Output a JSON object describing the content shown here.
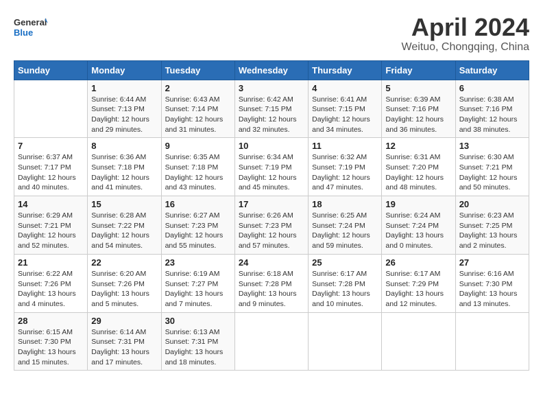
{
  "header": {
    "logo_general": "General",
    "logo_blue": "Blue",
    "month_year": "April 2024",
    "location": "Weituo, Chongqing, China"
  },
  "columns": [
    "Sunday",
    "Monday",
    "Tuesday",
    "Wednesday",
    "Thursday",
    "Friday",
    "Saturday"
  ],
  "weeks": [
    [
      {
        "day": "",
        "sunrise": "",
        "sunset": "",
        "daylight": ""
      },
      {
        "day": "1",
        "sunrise": "Sunrise: 6:44 AM",
        "sunset": "Sunset: 7:13 PM",
        "daylight": "Daylight: 12 hours and 29 minutes."
      },
      {
        "day": "2",
        "sunrise": "Sunrise: 6:43 AM",
        "sunset": "Sunset: 7:14 PM",
        "daylight": "Daylight: 12 hours and 31 minutes."
      },
      {
        "day": "3",
        "sunrise": "Sunrise: 6:42 AM",
        "sunset": "Sunset: 7:15 PM",
        "daylight": "Daylight: 12 hours and 32 minutes."
      },
      {
        "day": "4",
        "sunrise": "Sunrise: 6:41 AM",
        "sunset": "Sunset: 7:15 PM",
        "daylight": "Daylight: 12 hours and 34 minutes."
      },
      {
        "day": "5",
        "sunrise": "Sunrise: 6:39 AM",
        "sunset": "Sunset: 7:16 PM",
        "daylight": "Daylight: 12 hours and 36 minutes."
      },
      {
        "day": "6",
        "sunrise": "Sunrise: 6:38 AM",
        "sunset": "Sunset: 7:16 PM",
        "daylight": "Daylight: 12 hours and 38 minutes."
      }
    ],
    [
      {
        "day": "7",
        "sunrise": "Sunrise: 6:37 AM",
        "sunset": "Sunset: 7:17 PM",
        "daylight": "Daylight: 12 hours and 40 minutes."
      },
      {
        "day": "8",
        "sunrise": "Sunrise: 6:36 AM",
        "sunset": "Sunset: 7:18 PM",
        "daylight": "Daylight: 12 hours and 41 minutes."
      },
      {
        "day": "9",
        "sunrise": "Sunrise: 6:35 AM",
        "sunset": "Sunset: 7:18 PM",
        "daylight": "Daylight: 12 hours and 43 minutes."
      },
      {
        "day": "10",
        "sunrise": "Sunrise: 6:34 AM",
        "sunset": "Sunset: 7:19 PM",
        "daylight": "Daylight: 12 hours and 45 minutes."
      },
      {
        "day": "11",
        "sunrise": "Sunrise: 6:32 AM",
        "sunset": "Sunset: 7:19 PM",
        "daylight": "Daylight: 12 hours and 47 minutes."
      },
      {
        "day": "12",
        "sunrise": "Sunrise: 6:31 AM",
        "sunset": "Sunset: 7:20 PM",
        "daylight": "Daylight: 12 hours and 48 minutes."
      },
      {
        "day": "13",
        "sunrise": "Sunrise: 6:30 AM",
        "sunset": "Sunset: 7:21 PM",
        "daylight": "Daylight: 12 hours and 50 minutes."
      }
    ],
    [
      {
        "day": "14",
        "sunrise": "Sunrise: 6:29 AM",
        "sunset": "Sunset: 7:21 PM",
        "daylight": "Daylight: 12 hours and 52 minutes."
      },
      {
        "day": "15",
        "sunrise": "Sunrise: 6:28 AM",
        "sunset": "Sunset: 7:22 PM",
        "daylight": "Daylight: 12 hours and 54 minutes."
      },
      {
        "day": "16",
        "sunrise": "Sunrise: 6:27 AM",
        "sunset": "Sunset: 7:23 PM",
        "daylight": "Daylight: 12 hours and 55 minutes."
      },
      {
        "day": "17",
        "sunrise": "Sunrise: 6:26 AM",
        "sunset": "Sunset: 7:23 PM",
        "daylight": "Daylight: 12 hours and 57 minutes."
      },
      {
        "day": "18",
        "sunrise": "Sunrise: 6:25 AM",
        "sunset": "Sunset: 7:24 PM",
        "daylight": "Daylight: 12 hours and 59 minutes."
      },
      {
        "day": "19",
        "sunrise": "Sunrise: 6:24 AM",
        "sunset": "Sunset: 7:24 PM",
        "daylight": "Daylight: 13 hours and 0 minutes."
      },
      {
        "day": "20",
        "sunrise": "Sunrise: 6:23 AM",
        "sunset": "Sunset: 7:25 PM",
        "daylight": "Daylight: 13 hours and 2 minutes."
      }
    ],
    [
      {
        "day": "21",
        "sunrise": "Sunrise: 6:22 AM",
        "sunset": "Sunset: 7:26 PM",
        "daylight": "Daylight: 13 hours and 4 minutes."
      },
      {
        "day": "22",
        "sunrise": "Sunrise: 6:20 AM",
        "sunset": "Sunset: 7:26 PM",
        "daylight": "Daylight: 13 hours and 5 minutes."
      },
      {
        "day": "23",
        "sunrise": "Sunrise: 6:19 AM",
        "sunset": "Sunset: 7:27 PM",
        "daylight": "Daylight: 13 hours and 7 minutes."
      },
      {
        "day": "24",
        "sunrise": "Sunrise: 6:18 AM",
        "sunset": "Sunset: 7:28 PM",
        "daylight": "Daylight: 13 hours and 9 minutes."
      },
      {
        "day": "25",
        "sunrise": "Sunrise: 6:17 AM",
        "sunset": "Sunset: 7:28 PM",
        "daylight": "Daylight: 13 hours and 10 minutes."
      },
      {
        "day": "26",
        "sunrise": "Sunrise: 6:17 AM",
        "sunset": "Sunset: 7:29 PM",
        "daylight": "Daylight: 13 hours and 12 minutes."
      },
      {
        "day": "27",
        "sunrise": "Sunrise: 6:16 AM",
        "sunset": "Sunset: 7:30 PM",
        "daylight": "Daylight: 13 hours and 13 minutes."
      }
    ],
    [
      {
        "day": "28",
        "sunrise": "Sunrise: 6:15 AM",
        "sunset": "Sunset: 7:30 PM",
        "daylight": "Daylight: 13 hours and 15 minutes."
      },
      {
        "day": "29",
        "sunrise": "Sunrise: 6:14 AM",
        "sunset": "Sunset: 7:31 PM",
        "daylight": "Daylight: 13 hours and 17 minutes."
      },
      {
        "day": "30",
        "sunrise": "Sunrise: 6:13 AM",
        "sunset": "Sunset: 7:31 PM",
        "daylight": "Daylight: 13 hours and 18 minutes."
      },
      {
        "day": "",
        "sunrise": "",
        "sunset": "",
        "daylight": ""
      },
      {
        "day": "",
        "sunrise": "",
        "sunset": "",
        "daylight": ""
      },
      {
        "day": "",
        "sunrise": "",
        "sunset": "",
        "daylight": ""
      },
      {
        "day": "",
        "sunrise": "",
        "sunset": "",
        "daylight": ""
      }
    ]
  ]
}
